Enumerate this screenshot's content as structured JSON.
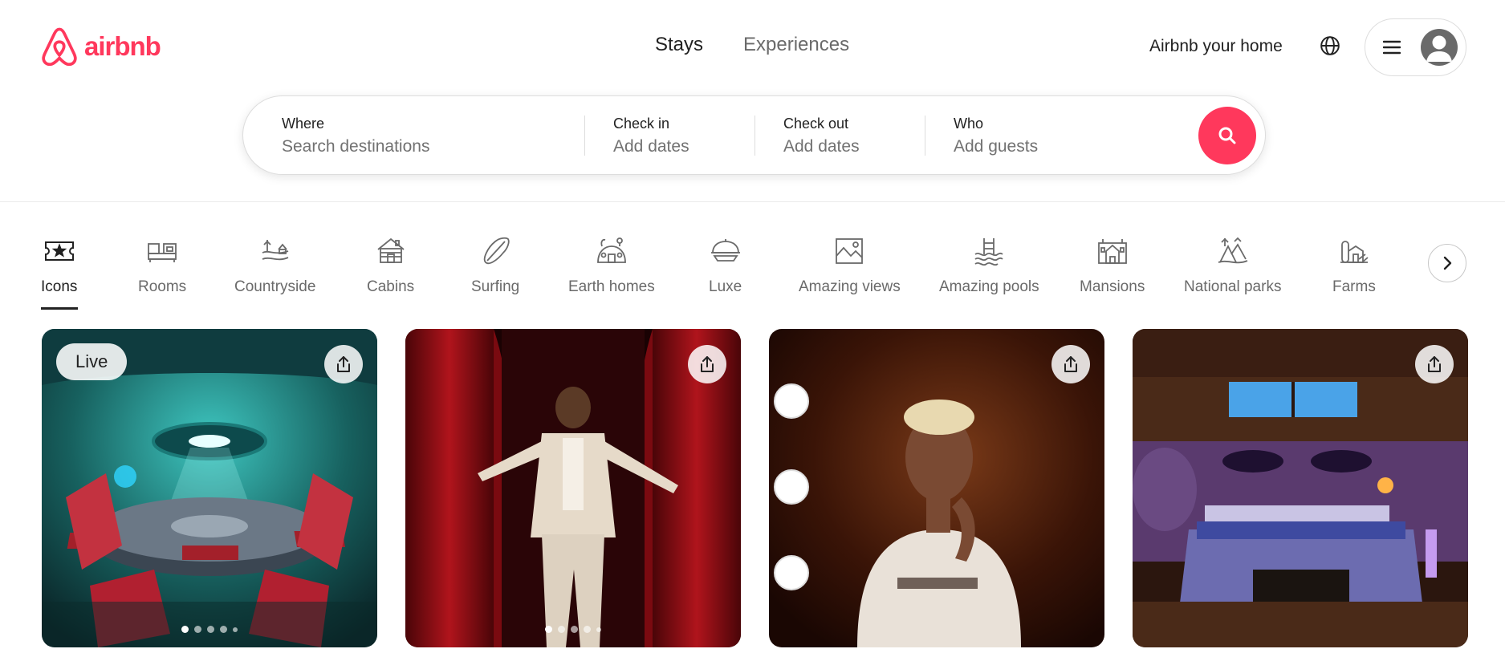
{
  "brand": {
    "name": "airbnb",
    "color": "#ff385c"
  },
  "nav": {
    "tabs": [
      "Stays",
      "Experiences"
    ],
    "active": "Stays"
  },
  "header": {
    "host_link": "Airbnb your home"
  },
  "search": {
    "where": {
      "label": "Where",
      "placeholder": "Search destinations"
    },
    "check_in": {
      "label": "Check in",
      "placeholder": "Add dates"
    },
    "check_out": {
      "label": "Check out",
      "placeholder": "Add dates"
    },
    "who": {
      "label": "Who",
      "placeholder": "Add guests"
    }
  },
  "categories": {
    "items": [
      {
        "label": "Icons",
        "icon": "ticket-star-icon",
        "active": true
      },
      {
        "label": "Rooms",
        "icon": "bed-icon"
      },
      {
        "label": "Countryside",
        "icon": "countryside-icon"
      },
      {
        "label": "Cabins",
        "icon": "cabin-icon"
      },
      {
        "label": "Surfing",
        "icon": "surfboard-icon"
      },
      {
        "label": "Earth homes",
        "icon": "earth-home-icon"
      },
      {
        "label": "Luxe",
        "icon": "cloche-icon"
      },
      {
        "label": "Amazing views",
        "icon": "mountain-view-icon"
      },
      {
        "label": "Amazing pools",
        "icon": "pool-icon"
      },
      {
        "label": "Mansions",
        "icon": "mansion-icon"
      },
      {
        "label": "National parks",
        "icon": "national-park-icon"
      },
      {
        "label": "Farms",
        "icon": "farm-icon"
      }
    ]
  },
  "cards": [
    {
      "badge": "Live",
      "dots": 5
    },
    {
      "dots": 5
    },
    {},
    {}
  ]
}
